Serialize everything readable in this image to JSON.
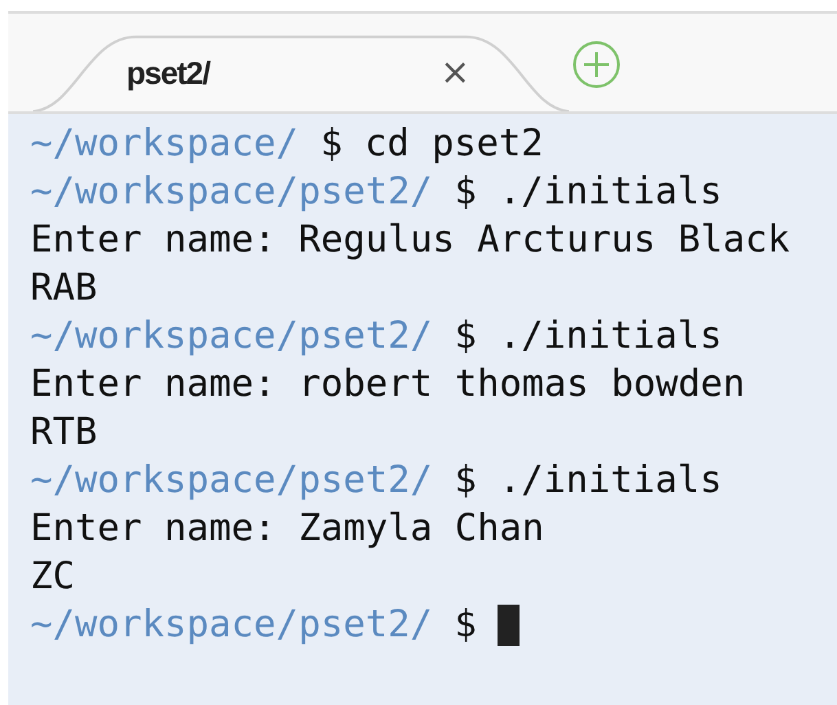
{
  "tabs": [
    {
      "label": "pset2/",
      "close": "×",
      "selected": true
    }
  ],
  "terminal": {
    "lines": [
      {
        "kind": "prompt",
        "path": "~/workspace/",
        "symbol": "$",
        "command": "cd pset2"
      },
      {
        "kind": "prompt",
        "path": "~/workspace/pset2/",
        "symbol": "$",
        "command": "./initials"
      },
      {
        "kind": "output",
        "text": "Enter name: Regulus Arcturus Black"
      },
      {
        "kind": "output",
        "text": "RAB"
      },
      {
        "kind": "prompt",
        "path": "~/workspace/pset2/",
        "symbol": "$",
        "command": "./initials"
      },
      {
        "kind": "output",
        "text": "Enter name: robert thomas bowden"
      },
      {
        "kind": "output",
        "text": "RTB"
      },
      {
        "kind": "prompt",
        "path": "~/workspace/pset2/",
        "symbol": "$",
        "command": "./initials"
      },
      {
        "kind": "output",
        "text": "Enter name: Zamyla Chan"
      },
      {
        "kind": "output",
        "text": "ZC"
      },
      {
        "kind": "prompt",
        "path": "~/workspace/pset2/",
        "symbol": "$",
        "cursor": true
      }
    ]
  }
}
